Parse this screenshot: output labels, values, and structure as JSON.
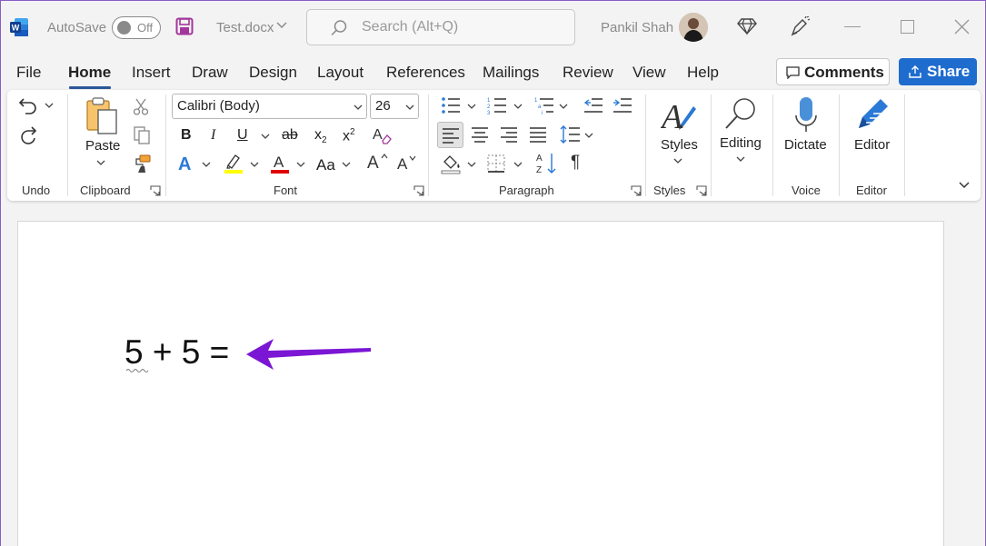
{
  "titlebar": {
    "autosave_label": "AutoSave",
    "autosave_state": "Off",
    "filename": "Test.docx",
    "search_placeholder": "Search (Alt+Q)",
    "user_name": "Pankil Shah"
  },
  "menu": {
    "tabs": [
      {
        "label": "File"
      },
      {
        "label": "Home",
        "active": true
      },
      {
        "label": "Insert"
      },
      {
        "label": "Draw"
      },
      {
        "label": "Design"
      },
      {
        "label": "Layout"
      },
      {
        "label": "References"
      },
      {
        "label": "Mailings"
      },
      {
        "label": "Review"
      },
      {
        "label": "View"
      },
      {
        "label": "Help"
      }
    ],
    "comments_label": "Comments",
    "share_label": "Share"
  },
  "ribbon": {
    "groups": {
      "undo": "Undo",
      "clipboard": "Clipboard",
      "font": "Font",
      "paragraph": "Paragraph",
      "styles": "Styles",
      "voice": "Voice",
      "editor": "Editor"
    },
    "paste_label": "Paste",
    "font_name": "Calibri (Body)",
    "font_size": "26",
    "styles_label": "Styles",
    "editing_label": "Editing",
    "dictate_label": "Dictate",
    "editor_label": "Editor",
    "format_glyphs": {
      "bold": "B",
      "italic": "I",
      "underline": "U",
      "strike": "ab",
      "subscript": "x",
      "subscript_mark": "2",
      "superscript": "x",
      "superscript_mark": "2",
      "text_effects": "A",
      "change_case": "Aa",
      "grow": "A",
      "shrink": "A",
      "pilcrow": "¶"
    }
  },
  "document": {
    "text": "5 + 5 ="
  },
  "colors": {
    "accent": "#2b579a",
    "share": "#1f6ccf",
    "arrow": "#7b16d4",
    "highlight": "#ffff00",
    "font_color": "#e00000"
  }
}
